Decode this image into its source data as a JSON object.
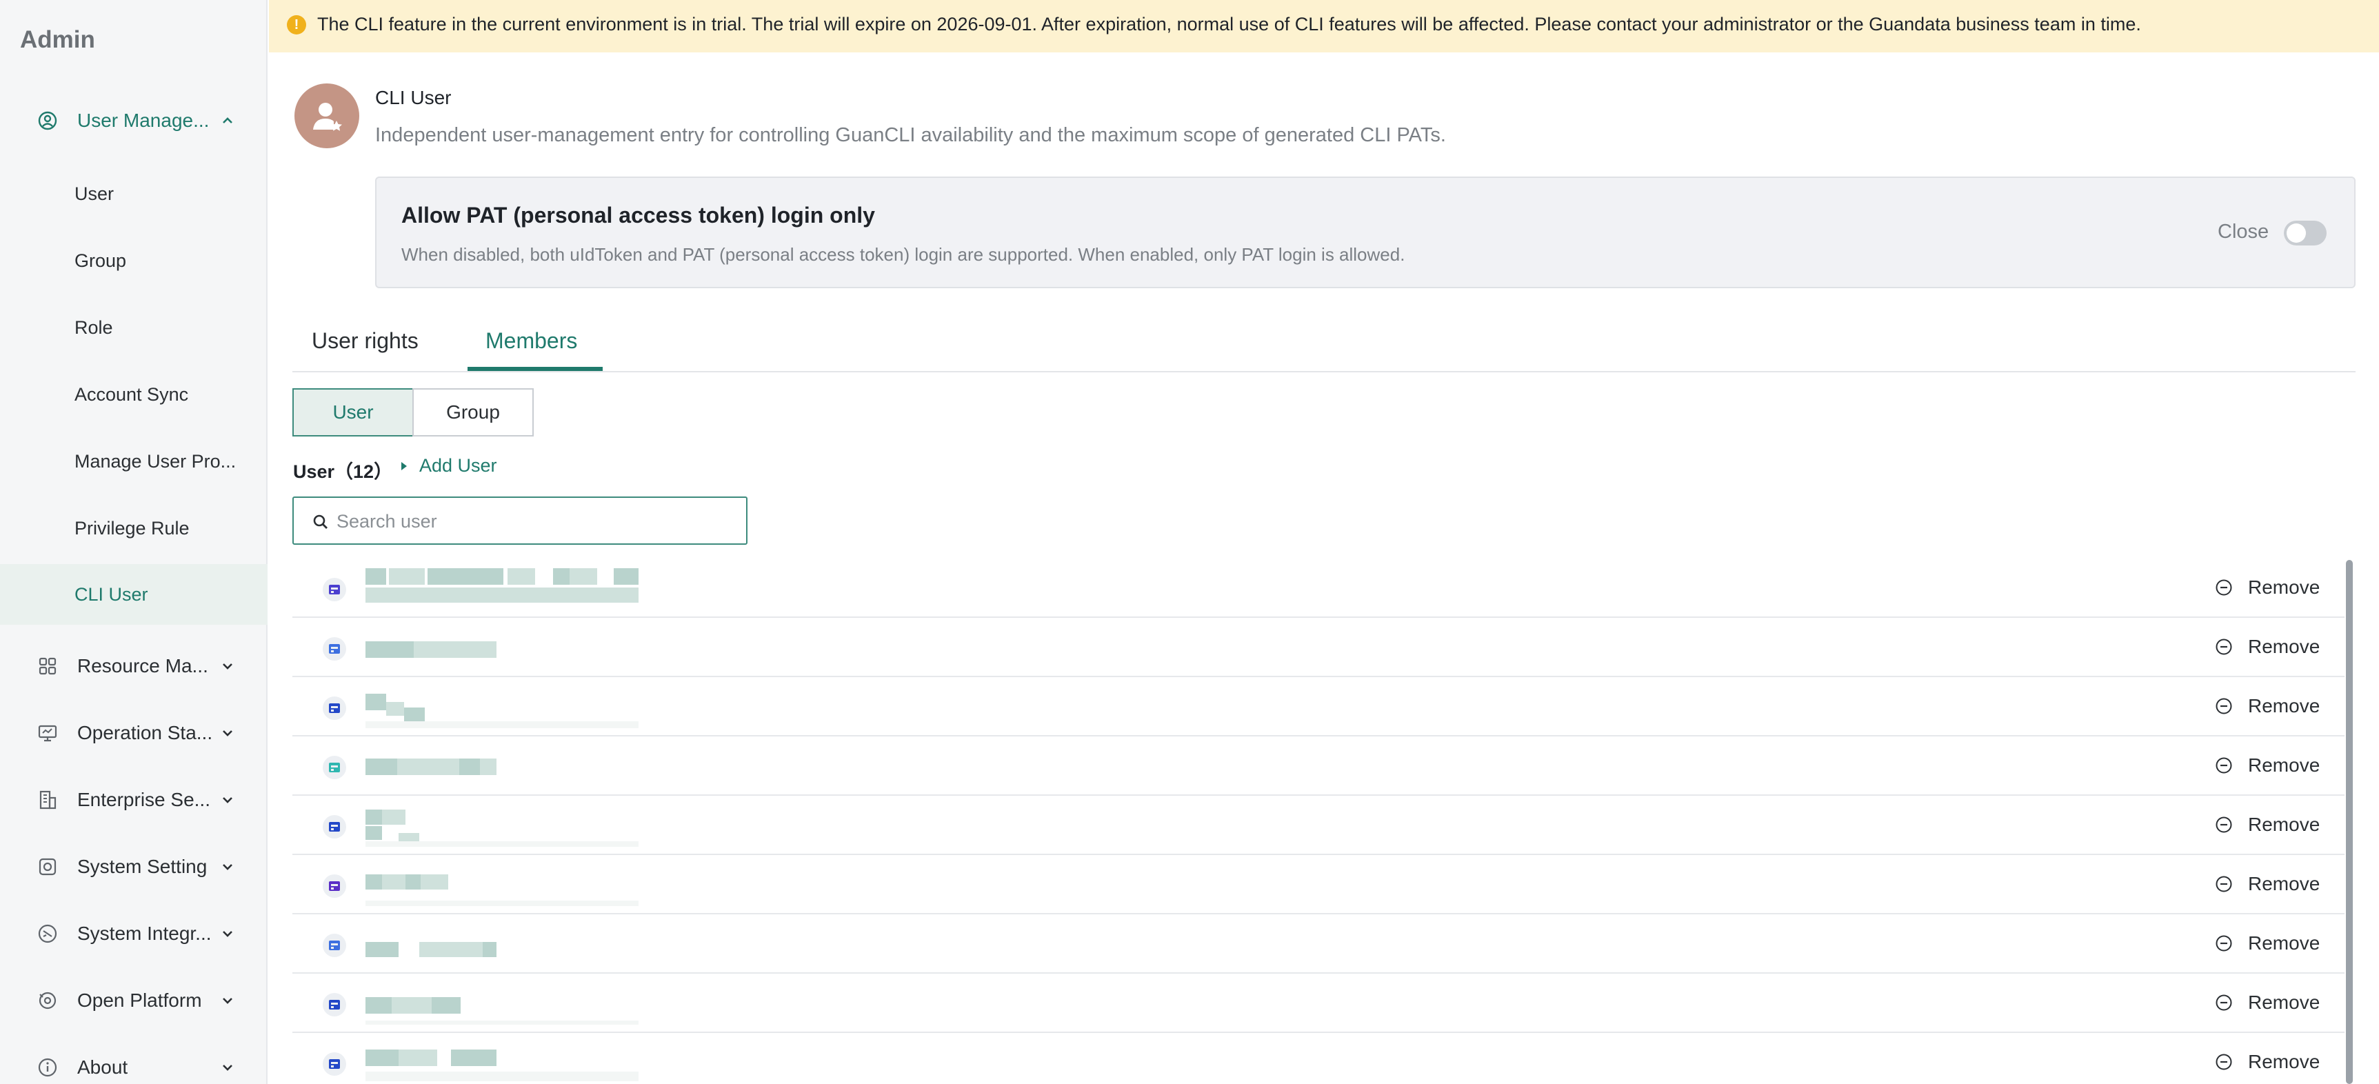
{
  "sidebar": {
    "title": "Admin",
    "groups": [
      {
        "label": "User Manage...",
        "icon": "user-circle-icon"
      },
      {
        "label": "Resource Ma...",
        "icon": "grid-icon"
      },
      {
        "label": "Operation Sta...",
        "icon": "monitor-icon"
      },
      {
        "label": "Enterprise Se...",
        "icon": "building-icon"
      },
      {
        "label": "System Setting",
        "icon": "settings-icon"
      },
      {
        "label": "System Integr...",
        "icon": "integration-icon"
      },
      {
        "label": "Open Platform",
        "icon": "platform-icon"
      },
      {
        "label": "About",
        "icon": "info-icon"
      }
    ],
    "items": [
      {
        "label": "User"
      },
      {
        "label": "Group"
      },
      {
        "label": "Role"
      },
      {
        "label": "Account Sync"
      },
      {
        "label": "Manage User Pro..."
      },
      {
        "label": "Privilege Rule"
      },
      {
        "label": "CLI User"
      }
    ]
  },
  "banner": {
    "text": "The CLI feature in the current environment is in trial. The trial will expire on 2026-09-01. After expiration, normal use of CLI features will be affected. Please contact your administrator or the Guandata business team in time.",
    "icon": "warning-icon"
  },
  "header": {
    "title": "CLI User",
    "description": "Independent user-management entry for controlling GuanCLI availability and the maximum scope of generated CLI PATs."
  },
  "pat": {
    "title": "Allow PAT (personal access token) login only",
    "description": "When disabled, both uIdToken and PAT (personal access token) login are supported. When enabled, only PAT login is allowed.",
    "state_label": "Close",
    "enabled": false
  },
  "tabs": [
    {
      "label": "User rights"
    },
    {
      "label": "Members"
    }
  ],
  "segment": {
    "user": "User",
    "group": "Group"
  },
  "members": {
    "count_label": "User（12）",
    "add_label": "Add User",
    "search_placeholder": "Search user",
    "remove_label": "Remove"
  },
  "colors": {
    "accent": "#1f7a6c",
    "banner_bg": "#fdf2d0",
    "warning": "#f0b11c"
  }
}
